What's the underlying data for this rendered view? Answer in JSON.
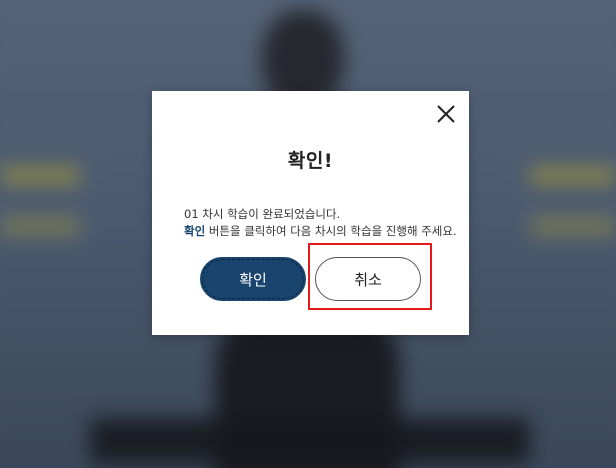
{
  "dialog": {
    "title": "확인!",
    "message_line1": "01 차시 학습이 완료되었습니다.",
    "message_line2_highlight": "확인",
    "message_line2_rest": " 버튼을 클릭하여 다음 차시의 학습을 진행해 주세요.",
    "confirm_label": "확인",
    "cancel_label": "취소",
    "close_icon": "close-icon"
  },
  "colors": {
    "primary": "#18446e",
    "highlight_border": "#e3191b",
    "dialog_bg": "#ffffff"
  }
}
